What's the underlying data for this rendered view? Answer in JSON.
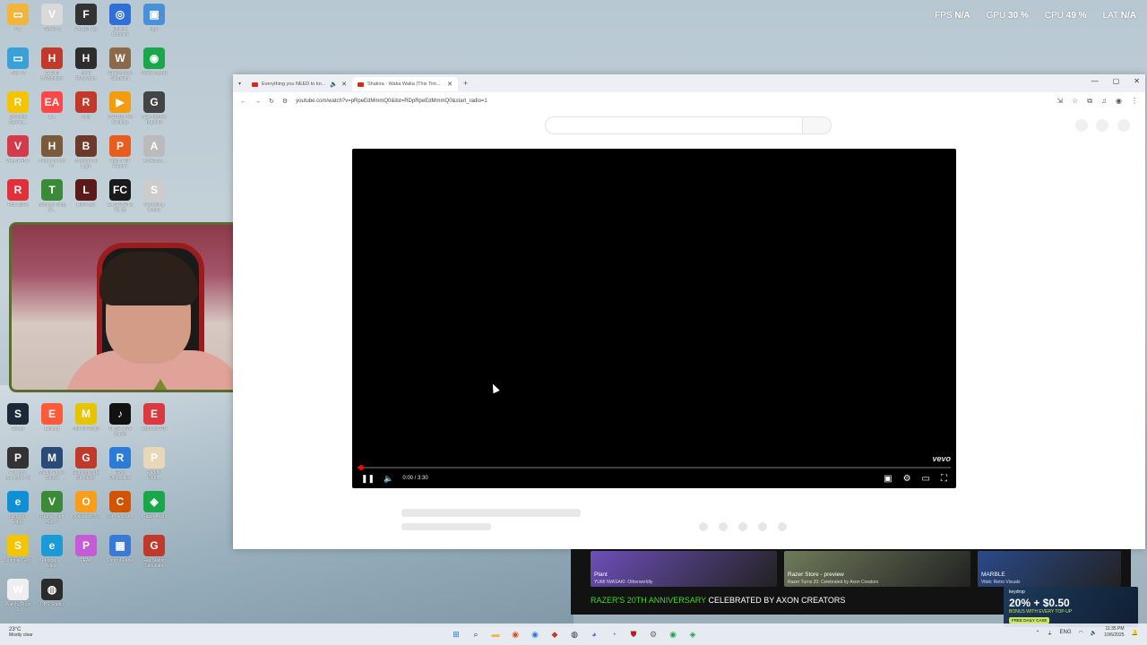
{
  "stats": [
    {
      "label": "FPS",
      "value": "N/A"
    },
    {
      "label": "GPU",
      "value": "30 %"
    },
    {
      "label": "CPU",
      "value": "49 %"
    },
    {
      "label": "LAT",
      "value": "N/A"
    }
  ],
  "desktop_icons": [
    {
      "label": "PC",
      "color": "#f2b53b",
      "glyph": "▭"
    },
    {
      "label": "Vertex 3",
      "color": "#d9d9d9",
      "glyph": "V"
    },
    {
      "label": "FACEIT AC",
      "color": "#333333",
      "glyph": "F"
    },
    {
      "label": "Ubisoft Connect",
      "color": "#2f6fd6",
      "glyph": "◎"
    },
    {
      "label": "logo",
      "color": "#4a90d9",
      "glyph": "▣"
    },
    {
      "label": "This PC",
      "color": "#3aa0d8",
      "glyph": "▭"
    },
    {
      "label": "CPUID HWMonitor",
      "color": "#c0392b",
      "glyph": "H"
    },
    {
      "label": "Hotel Renovator",
      "color": "#2d2d2d",
      "glyph": "H"
    },
    {
      "label": "Wrap House Simulator",
      "color": "#8a6a4a",
      "glyph": "W"
    },
    {
      "label": "Razer Cortex",
      "color": "#1aa64a",
      "glyph": "◉"
    },
    {
      "label": "Rockstar Games...",
      "color": "#f5c400",
      "glyph": "R"
    },
    {
      "label": "EA",
      "color": "#ff4747",
      "glyph": "EA"
    },
    {
      "label": "Rust",
      "color": "#c0392b",
      "glyph": "R"
    },
    {
      "label": "OVRGO Pro Desktop",
      "color": "#f39c12",
      "glyph": "▶"
    },
    {
      "label": "Get Harmed Together",
      "color": "#444444",
      "glyph": "G"
    },
    {
      "label": "VALORANT",
      "color": "#d33b4a",
      "glyph": "V"
    },
    {
      "label": "Hearts of Iron IV",
      "color": "#7a5a3a",
      "glyph": "H"
    },
    {
      "label": "Brothers Of Light",
      "color": "#6b3a2a",
      "glyph": "B"
    },
    {
      "label": "Flash PDF Reader",
      "color": "#e85d1f",
      "glyph": "P"
    },
    {
      "label": "AccelCon...",
      "color": "#bbbbbb",
      "glyph": "A"
    },
    {
      "label": "Riot Client",
      "color": "#e0313b",
      "glyph": "R"
    },
    {
      "label": "Tobacco Shop Si...",
      "color": "#3a8a3a",
      "glyph": "T"
    },
    {
      "label": "Liar's Bar",
      "color": "#5a1a1a",
      "glyph": "L"
    },
    {
      "label": "EA SPORTS FC 25",
      "color": "#1a1a1a",
      "glyph": "FC"
    },
    {
      "label": "Streaming Center",
      "color": "#cccccc",
      "glyph": "S"
    },
    {
      "label": "Steam",
      "color": "#1b2838",
      "glyph": "S"
    },
    {
      "label": "ExitLag",
      "color": "#ff5a3c",
      "glyph": "E"
    },
    {
      "label": "Marvel Rivals",
      "color": "#e8c400",
      "glyph": "M"
    },
    {
      "label": "TikTok LIVE Studio",
      "color": "#111111",
      "glyph": "♪"
    },
    {
      "label": "ExpressVPN",
      "color": "#da3940",
      "glyph": "E"
    },
    {
      "label": "Paradox Launcher v2",
      "color": "#333333",
      "glyph": "P"
    },
    {
      "label": "Media Player Classic",
      "color": "#2a4a7a",
      "glyph": "M"
    },
    {
      "label": "Gaming Cafe Simulator",
      "color": "#c0392b",
      "glyph": "G"
    },
    {
      "label": "Revo Uninstaller",
      "color": "#2c7bd6",
      "glyph": "R"
    },
    {
      "label": "Paddle Padd...",
      "color": "#e8d8b8",
      "glyph": "P"
    },
    {
      "label": "Microsoft Edge",
      "color": "#0f8fd6",
      "glyph": "e"
    },
    {
      "label": "Grand Theft Auto V",
      "color": "#3a8a3a",
      "glyph": "V"
    },
    {
      "label": "Overwatch® 2",
      "color": "#f99e1a",
      "glyph": "O"
    },
    {
      "label": "Car Mechan...",
      "color": "#d35400",
      "glyph": "C"
    },
    {
      "label": "Razer Axon",
      "color": "#1aa64a",
      "glyph": "◈"
    },
    {
      "label": "Stumble Guys",
      "color": "#f5c400",
      "glyph": "S"
    },
    {
      "label": "Person 1 - Edge",
      "color": "#1a9ad6",
      "glyph": "e"
    },
    {
      "label": "PEAK",
      "color": "#c55bd6",
      "glyph": "P"
    },
    {
      "label": "Control Panel",
      "color": "#3a7ad6",
      "glyph": "▦"
    },
    {
      "label": "Gas Station Simulator",
      "color": "#c0392b",
      "glyph": "G"
    },
    {
      "label": "Watch_Dogs 2",
      "color": "#eeeeee",
      "glyph": "W"
    },
    {
      "label": "OBS Studio",
      "color": "#2b2b2b",
      "glyph": "◍"
    }
  ],
  "browser": {
    "tabs": [
      {
        "title": "Everything you NEED to kn...",
        "active": false
      },
      {
        "title": "Shakira - Waka Waka (This Tim...",
        "active": true
      }
    ],
    "url": "youtube.com/watch?v=pRpeEdMmmQ0&list=RDpRpeEdMmmQ0&start_radio=1",
    "window_controls": [
      "—",
      "▢",
      "✕"
    ]
  },
  "player": {
    "time": "0:00 / 3:30",
    "progress_fraction": 0.0,
    "watermark": "vevo"
  },
  "razer": {
    "cards": [
      {
        "title": "Plant",
        "subtitle": "YUMI IWASAKI: Otherworldly",
        "color": "#6c4fb8"
      },
      {
        "title": "Razer Store - preview",
        "subtitle": "Razer Turns 20: Celebrated by Axon Creators",
        "color": "#6f7a5a"
      },
      {
        "title": "MARBLE",
        "subtitle": "Vitek: Retro Visuals",
        "color": "#2a4a8a"
      }
    ],
    "headline_accent": "RAZER'S 20TH ANNIVERSARY",
    "headline_rest": "CELEBRATED BY AXON CREATORS"
  },
  "ad": {
    "brand": "keydrop",
    "offer": "20% + $0.50",
    "tagline": "BONUS WITH EVERY TOP-UP",
    "badge": "FREE DAILY CASE"
  },
  "taskbar": {
    "weather_temp": "23°C",
    "weather_desc": "Mostly clear",
    "language": "ENG",
    "time": "11:35 PM",
    "date": "10/6/2025"
  }
}
